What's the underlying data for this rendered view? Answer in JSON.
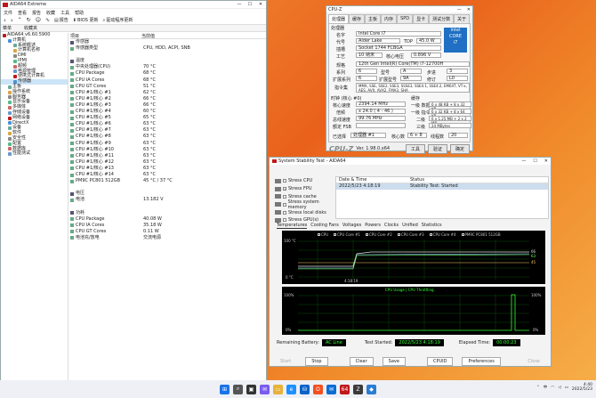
{
  "aida": {
    "title": "AIDA64 Extreme",
    "menu": [
      "文件",
      "查看",
      "报告",
      "收藏",
      "工具",
      "帮助"
    ],
    "toolbar": [
      "报告",
      "BIOS 更新",
      "驱动程序更新"
    ],
    "tabs": [
      "菜单",
      "收藏夹"
    ],
    "tree": [
      {
        "label": "AIDA64 v6.60.5900",
        "level": 0
      },
      {
        "label": "计算机",
        "level": 1
      },
      {
        "label": "系统概述",
        "level": 2
      },
      {
        "label": "计算机名称",
        "level": 2
      },
      {
        "label": "DMI",
        "level": 2
      },
      {
        "label": "IPMI",
        "level": 2
      },
      {
        "label": "超频",
        "level": 2
      },
      {
        "label": "电源管理",
        "level": 2
      },
      {
        "label": "便携式计算机",
        "level": 2
      },
      {
        "label": "传感器",
        "level": 2,
        "selected": true
      },
      {
        "label": "主板",
        "level": 1
      },
      {
        "label": "操作系统",
        "level": 1
      },
      {
        "label": "服务器",
        "level": 1
      },
      {
        "label": "显示设备",
        "level": 1
      },
      {
        "label": "多媒体",
        "level": 1
      },
      {
        "label": "存储设备",
        "level": 1
      },
      {
        "label": "网络设备",
        "level": 1
      },
      {
        "label": "DirectX",
        "level": 1
      },
      {
        "label": "设备",
        "level": 1
      },
      {
        "label": "软件",
        "level": 1
      },
      {
        "label": "安全性",
        "level": 1
      },
      {
        "label": "配置",
        "level": 1
      },
      {
        "label": "数据库",
        "level": 1
      },
      {
        "label": "性能测试",
        "level": 1
      }
    ],
    "columns": [
      "项目",
      "当前值"
    ],
    "rows": [
      {
        "a": "传感器",
        "b": "",
        "sec": true
      },
      {
        "a": "传感器类型",
        "b": "CPU, HDD, ACPI, SNB"
      },
      {
        "a": "",
        "b": ""
      },
      {
        "a": "温度",
        "b": "",
        "sec": true
      },
      {
        "a": "中央处理器(CPU)",
        "b": "70 °C"
      },
      {
        "a": "CPU Package",
        "b": "68 °C"
      },
      {
        "a": "CPU IA Cores",
        "b": "68 °C"
      },
      {
        "a": "CPU GT Cores",
        "b": "51 °C"
      },
      {
        "a": "CPU #1/核心 #1",
        "b": "62 °C"
      },
      {
        "a": "CPU #1/核心 #2",
        "b": "66 °C"
      },
      {
        "a": "CPU #1/核心 #3",
        "b": "66 °C"
      },
      {
        "a": "CPU #1/核心 #4",
        "b": "60 °C"
      },
      {
        "a": "CPU #1/核心 #5",
        "b": "65 °C"
      },
      {
        "a": "CPU #1/核心 #6",
        "b": "63 °C"
      },
      {
        "a": "CPU #1/核心 #7",
        "b": "63 °C"
      },
      {
        "a": "CPU #1/核心 #8",
        "b": "63 °C"
      },
      {
        "a": "CPU #1/核心 #9",
        "b": "63 °C"
      },
      {
        "a": "CPU #1/核心 #10",
        "b": "63 °C"
      },
      {
        "a": "CPU #1/核心 #11",
        "b": "63 °C"
      },
      {
        "a": "CPU #1/核心 #12",
        "b": "63 °C"
      },
      {
        "a": "CPU #1/核心 #13",
        "b": "63 °C"
      },
      {
        "a": "CPU #1/核心 #14",
        "b": "63 °C"
      },
      {
        "a": "PM9C PC801 512GB",
        "b": "45 °C / 37 °C"
      },
      {
        "a": "",
        "b": ""
      },
      {
        "a": "电压",
        "b": "",
        "sec": true
      },
      {
        "a": "电池",
        "b": "13.182 V"
      },
      {
        "a": "",
        "b": ""
      },
      {
        "a": "功耗",
        "b": "",
        "sec": true
      },
      {
        "a": "CPU Package",
        "b": "40.08 W"
      },
      {
        "a": "CPU IA Cores",
        "b": "35.18 W"
      },
      {
        "a": "CPU GT Cores",
        "b": "0.11 W"
      },
      {
        "a": "电池充/放电",
        "b": "交流电源"
      }
    ]
  },
  "cpuz": {
    "title": "CPU-Z",
    "tabs": [
      "处理器",
      "缓存",
      "主板",
      "内存",
      "SPD",
      "显卡",
      "测试分数",
      "关于"
    ],
    "name_label": "名字",
    "name": "Intel Core i7",
    "codename_label": "代号",
    "codename": "Alder Lake",
    "tdp_label": "TDP",
    "tdp": "45.0 W",
    "package_label": "插槽",
    "package": "Socket 1744 FCBGA",
    "tech_label": "工艺",
    "tech": "10 纳米",
    "vcore_label": "核心电压",
    "vcore": "0.896 V",
    "spec_label": "规格",
    "spec": "12th Gen Intel(R) Core(TM) i7-12700H",
    "family_label": "系列",
    "family": "6",
    "model_label": "型号",
    "model": "A",
    "stepping_label": "步进",
    "stepping": "3",
    "extfamily_label": "扩展系列",
    "extfamily": "6",
    "extmodel_label": "扩展型号",
    "extmodel": "9A",
    "revision_label": "修订",
    "revision": "L0",
    "instr_label": "指令集",
    "instr": "MMX, SSE, SSE2, SSE3, SSSE3, SSE4.1, SSE4.2, EM64T, VT-x, AES, AVX, AVX2, FMA3, SHA",
    "clocks_title": "时钟 (核心 #0)",
    "cache_title": "缓存",
    "core_speed_label": "核心速度",
    "core_speed": "2394.14 MHz",
    "mult_label": "倍频",
    "mult": "x 24.0 ( 4 - 46 )",
    "bus_label": "总线速度",
    "bus": "99.76 MHz",
    "fsb_label": "额定 FSB",
    "fsb": "",
    "l1d_label": "一级 数据",
    "l1d": "6 x 48 KB + 8 x 32 KB",
    "l1i_label": "一级 指令",
    "l1i": "6 x 32 KB + 8 x 64 KB",
    "l2_label": "二级",
    "l2": "6 x 1.25 MB + 2 x 2 MB",
    "l3_label": "三级",
    "l3": "24 MBytes",
    "selected_label": "已选择",
    "selected": "处理器 #1",
    "cores_label": "核心数",
    "cores": "6 + 8",
    "threads_label": "线程数",
    "threads": "20",
    "version": "Ver. 1.98.0.x64",
    "tools_btn": "工具",
    "validate_btn": "验证",
    "ok_btn": "确定"
  },
  "stability": {
    "title": "System Stability Test - AIDA64",
    "checks": [
      {
        "label": "Stress CPU",
        "on": false
      },
      {
        "label": "Stress FPU",
        "on": true
      },
      {
        "label": "Stress cache",
        "on": false
      },
      {
        "label": "Stress system memory",
        "on": false
      },
      {
        "label": "Stress local disks",
        "on": false
      },
      {
        "label": "Stress GPU(s)",
        "on": false
      }
    ],
    "table_headers": [
      "Date & Time",
      "Status"
    ],
    "table_row": [
      "2022/5/23 4:18:19",
      "Stability Test: Started"
    ],
    "graph_tabs": [
      "Temperatures",
      "Cooling Fans",
      "Voltages",
      "Powers",
      "Clocks",
      "Unified",
      "Statistics"
    ],
    "legend": [
      "CPU",
      "CPU Core #1",
      "CPU Core #2",
      "CPU Core #3",
      "CPU Core #4",
      "PM9C PC801 512GB"
    ],
    "graph1_top": "100 °C",
    "graph1_bottom": "0 °C",
    "graph1_time": "4:18:19",
    "graph1_right": [
      "66",
      "63",
      "45"
    ],
    "graph2_title": "CPU Usage | CPU Throttling",
    "graph2_top": "100%",
    "graph2_bottom": "0%",
    "graph2_right_top": "100%",
    "graph2_right_bottom": "0%",
    "battery_label": "Remaining Battery:",
    "battery": "AC Line",
    "started_label": "Test Started:",
    "started": "2022/5/23 4:18:19",
    "elapsed_label": "Elapsed Time:",
    "elapsed": "00:00:23",
    "buttons": [
      "Start",
      "Stop",
      "Clear",
      "Save",
      "CPUID",
      "Preferences",
      "Close"
    ]
  },
  "taskbar": {
    "time": "4:40",
    "date": "2022/5/23",
    "tray_lang": "中"
  },
  "colors": {
    "accent": "#1f6fc4",
    "graph_green": "#33ff33",
    "aida_red": "#c0181b"
  }
}
